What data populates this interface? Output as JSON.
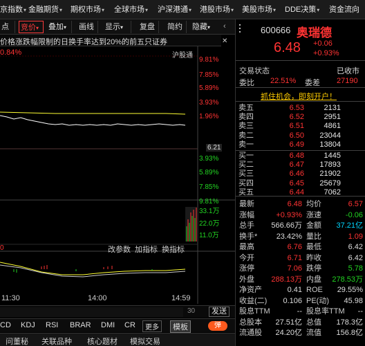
{
  "menu": [
    "京指数",
    "金融期货",
    "期权市场",
    "全球市场",
    "沪深港通",
    "港股市场",
    "美股市场",
    "DDE决策",
    "资金流向"
  ],
  "toolbar": [
    "点",
    "竞价",
    "叠加",
    "画线",
    "显示",
    "复盘",
    "简约",
    "隐藏"
  ],
  "notice": "价格涨跌幅限制的日换手率达到20%的前五只证券",
  "chart": {
    "pct_top": "0.84%",
    "exchange": "沪股通",
    "scale_up": [
      "9.81%",
      "7.85%",
      "5.89%",
      "3.93%",
      "1.96%"
    ],
    "scale_mid": "6.21",
    "scale_down": [
      "3.93%",
      "5.89%",
      "7.85%",
      "9.81%"
    ],
    "volume_labels": [
      "33.1万",
      "22.0万",
      "11.0万"
    ],
    "bottom_toolbar": [
      "改参数",
      "加指标",
      "换指标"
    ],
    "left_marker": "0",
    "time_labels": [
      "11:30",
      "14:00",
      "14:59"
    ]
  },
  "input_bar": {
    "count": "30",
    "send": "发送"
  },
  "indicators": [
    "CD",
    "KDJ",
    "RSI",
    "BRAR",
    "DMI",
    "CR"
  ],
  "more_label": "更多",
  "template_label": "模板",
  "toggle_label": "弹",
  "tabs": [
    "问董秘",
    "关联品种",
    "核心题材",
    "模拟交易"
  ],
  "quote": {
    "code": "600666",
    "name": "奥瑞德",
    "price": "6.48",
    "change": "+0.06",
    "change_pct": "+0.93%",
    "status_label": "交易状态",
    "status_value": "已收市",
    "ratio_label": "委比",
    "ratio_value": "22.51%",
    "diff_label": "委差",
    "diff_value": "27190",
    "ad": "抓住机会，即刻开户！"
  },
  "sells": [
    {
      "label": "卖五",
      "price": "6.53",
      "vol": "2131"
    },
    {
      "label": "卖四",
      "price": "6.52",
      "vol": "2951"
    },
    {
      "label": "卖三",
      "price": "6.51",
      "vol": "4861"
    },
    {
      "label": "卖二",
      "price": "6.50",
      "vol": "23044"
    },
    {
      "label": "卖一",
      "price": "6.49",
      "vol": "13804"
    }
  ],
  "buys": [
    {
      "label": "买一",
      "price": "6.48",
      "vol": "1445"
    },
    {
      "label": "买二",
      "price": "6.47",
      "vol": "17893"
    },
    {
      "label": "买三",
      "price": "6.46",
      "vol": "21902"
    },
    {
      "label": "买四",
      "price": "6.45",
      "vol": "25679"
    },
    {
      "label": "买五",
      "price": "6.44",
      "vol": "7062"
    }
  ],
  "stats": [
    {
      "k1": "最新",
      "v1": "6.48",
      "c1": "#ff3333",
      "k2": "均价",
      "v2": "6.57",
      "c2": "#ff3333"
    },
    {
      "k1": "涨幅",
      "v1": "+0.93%",
      "c1": "#ff3333",
      "k2": "涨速",
      "v2": "-0.06",
      "c2": "#22d422"
    },
    {
      "k1": "总手",
      "v1": "566.66万",
      "c1": "#dddddd",
      "k2": "金额",
      "v2": "37.21亿",
      "c2": "#00d6ff"
    },
    {
      "k1": "换手*",
      "v1": "23.42%",
      "c1": "#dddddd",
      "k2": "量比",
      "v2": "1.09",
      "c2": "#ff3333"
    },
    {
      "k1": "最高",
      "v1": "6.76",
      "c1": "#ff3333",
      "k2": "最低",
      "v2": "6.42",
      "c2": "#dddddd"
    },
    {
      "k1": "今开",
      "v1": "6.71",
      "c1": "#ff3333",
      "k2": "昨收",
      "v2": "6.42",
      "c2": "#dddddd"
    },
    {
      "k1": "涨停",
      "v1": "7.06",
      "c1": "#ff3333",
      "k2": "跌停",
      "v2": "5.78",
      "c2": "#22d422"
    },
    {
      "k1": "外盘",
      "v1": "288.13万",
      "c1": "#ff3333",
      "k2": "内盘",
      "v2": "278.53万",
      "c2": "#22d422"
    },
    {
      "k1": "净资产",
      "v1": "0.41",
      "c1": "#dddddd",
      "k2": "ROE",
      "v2": "29.55%",
      "c2": "#dddddd"
    },
    {
      "k1": "收益(二)",
      "v1": "0.106",
      "c1": "#dddddd",
      "k2": "PE(动)",
      "v2": "45.98",
      "c2": "#dddddd"
    },
    {
      "k1": "股息TTM",
      "v1": "--",
      "c1": "#dddddd",
      "k2": "股息率TTM",
      "v2": "--",
      "c2": "#dddddd"
    },
    {
      "k1": "总股本",
      "v1": "27.51亿",
      "c1": "#dddddd",
      "k2": "总值",
      "v2": "178.3亿",
      "c2": "#dddddd"
    },
    {
      "k1": "流通股",
      "v1": "24.20亿",
      "c1": "#dddddd",
      "k2": "流值",
      "v2": "156.8亿",
      "c2": "#dddddd"
    }
  ],
  "colors": {
    "up": "#ff3333",
    "down": "#22d422",
    "price_line": "#ffffff",
    "avg_line": "#ffff33",
    "blue": "#00d6ff"
  }
}
